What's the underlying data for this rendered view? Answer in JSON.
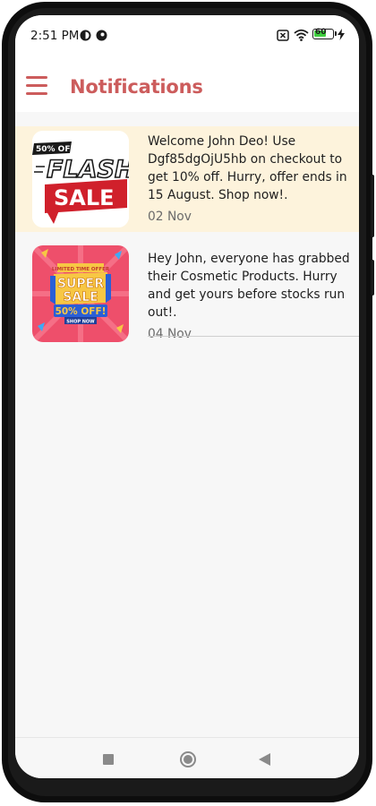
{
  "status_bar": {
    "time": "2:51 PM",
    "battery_level": "60"
  },
  "app_bar": {
    "title": "Notifications",
    "menu_icon": "hamburger-menu-icon"
  },
  "notifications": [
    {
      "message": "Welcome John Deo! Use Dgf85dgOjU5hb on checkout to get 10% off. Hurry, offer ends in 15 August. Shop now!.",
      "date": "02 Nov",
      "highlighted": true,
      "thumbnail": {
        "badge": "50% OFF",
        "line1": "FLASH",
        "line2": "SALE"
      }
    },
    {
      "message": "Hey John, everyone has grabbed their Cosmetic Products. Hurry and get yours before stocks run out!.",
      "date": "04 Nov",
      "highlighted": false,
      "thumbnail": {
        "top": "LIMITED TIME OFFER",
        "line1": "SUPER",
        "line2": "SALE",
        "badge": "50% OFF!",
        "cta": "SHOP NOW"
      }
    }
  ],
  "colors": {
    "accent": "#cc5c5c",
    "highlight_bg": "#fdf3dc",
    "screen_bg": "#f7f7f7"
  },
  "nav_bar": {
    "icons": [
      "recents-square-icon",
      "home-circle-icon",
      "back-triangle-icon"
    ]
  }
}
